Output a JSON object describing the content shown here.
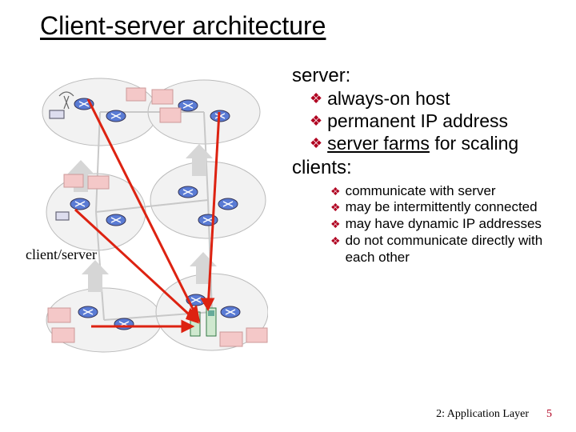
{
  "title": "Client-server architecture",
  "diagram_caption": "client/server",
  "server": {
    "heading": "server:",
    "bullets": [
      "always-on host",
      "permanent IP address",
      "<span class='underline'>server farms</span> for scaling"
    ]
  },
  "clients": {
    "heading": "clients:",
    "bullets": [
      "communicate with server",
      "may be intermittently connected",
      "may have dynamic IP addresses",
      "do not communicate directly with each other"
    ]
  },
  "footer": {
    "chapter": "2: Application Layer",
    "page": "5"
  },
  "glyphs": {
    "diamond": "❖"
  }
}
